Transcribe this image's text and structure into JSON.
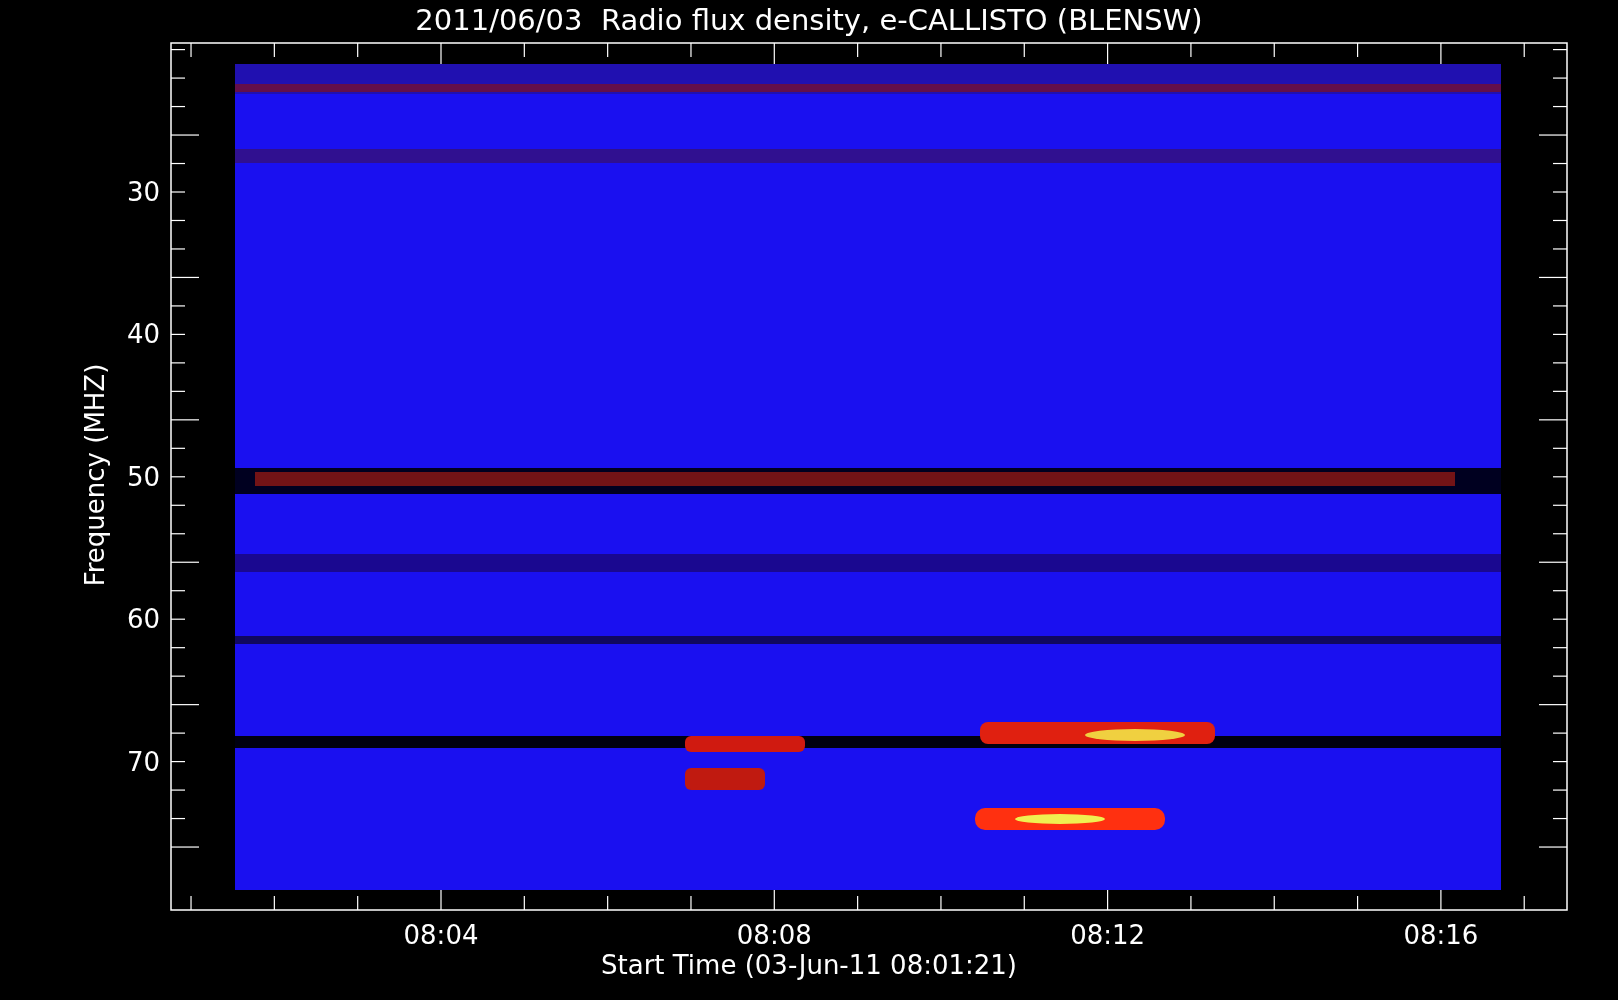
{
  "title": "2011/06/03  Radio flux density, e-CALLISTO (BLENSW)",
  "y_axis": {
    "label": "Frequency (MHZ)",
    "ticks": [
      "30",
      "40",
      "50",
      "60",
      "70"
    ]
  },
  "x_axis": {
    "label": "Start Time (03-Jun-11 08:01:21)",
    "ticks": [
      "08:04",
      "08:08",
      "08:12",
      "08:16"
    ]
  }
}
